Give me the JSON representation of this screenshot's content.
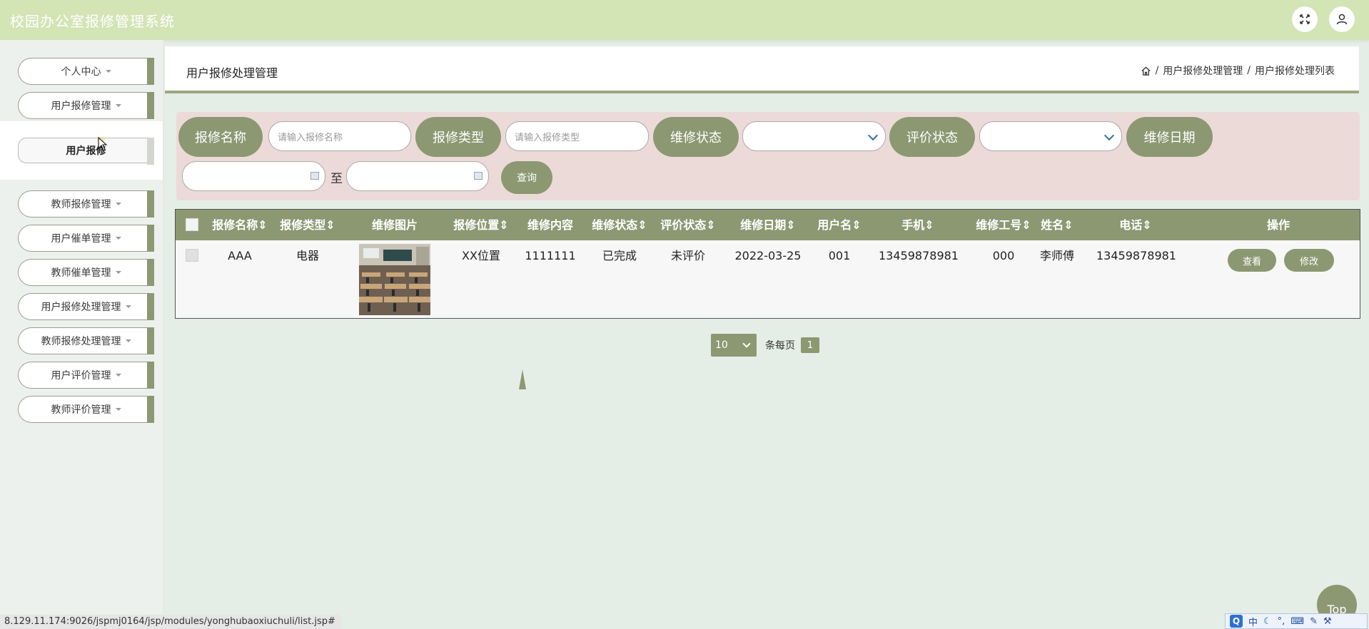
{
  "app": {
    "title": "校园办公室报修管理系统"
  },
  "sidebar": {
    "items": [
      {
        "label": "个人中心"
      },
      {
        "label": "用户报修管理"
      },
      {
        "label": "用户报修"
      },
      {
        "label": "教师报修管理"
      },
      {
        "label": "用户催单管理"
      },
      {
        "label": "教师催单管理"
      },
      {
        "label": "用户报修处理管理"
      },
      {
        "label": "教师报修处理管理"
      },
      {
        "label": "用户评价管理"
      },
      {
        "label": "教师评价管理"
      }
    ]
  },
  "header": {
    "page_title": "用户报修处理管理",
    "breadcrumb": [
      "用户报修处理管理",
      "用户报修处理列表"
    ],
    "separator": "/"
  },
  "filters": {
    "name_label": "报修名称",
    "name_placeholder": "请输入报修名称",
    "type_label": "报修类型",
    "type_placeholder": "请输入报修类型",
    "repair_status_label": "维修状态",
    "eval_status_label": "评价状态",
    "date_label": "维修日期",
    "to_label": "至",
    "search_label": "查询"
  },
  "table": {
    "columns": [
      "报修名称",
      "报修类型",
      "维修图片",
      "报修位置",
      "维修内容",
      "维修状态",
      "评价状态",
      "维修日期",
      "用户名",
      "手机",
      "维修工号",
      "姓名",
      "电话",
      "操作"
    ],
    "rows": [
      {
        "name": "AAA",
        "type": "电器",
        "location": "XX位置",
        "content": "1111111",
        "repair_status": "已完成",
        "eval_status": "未评价",
        "date": "2022-03-25",
        "username": "001",
        "phone": "13459878981",
        "worker_id": "000",
        "worker_name": "李师傅",
        "tel": "13459878981",
        "view_label": "查看",
        "edit_label": "修改"
      }
    ]
  },
  "pagination": {
    "page_size": "10",
    "per_page_label": "条每页",
    "current_page": "1"
  },
  "status_bar": {
    "url": "8.129.11.174:9026/jspmj0164/jsp/modules/yonghubaoxiuchuli/list.jsp#"
  },
  "back_to_top": "Top",
  "ime": {
    "mode": "中"
  },
  "colors": {
    "topbar": "#d3e4b5",
    "accent": "#8c9872",
    "filter_bg": "#ecdad8",
    "page_bg": "#e4eee6"
  }
}
